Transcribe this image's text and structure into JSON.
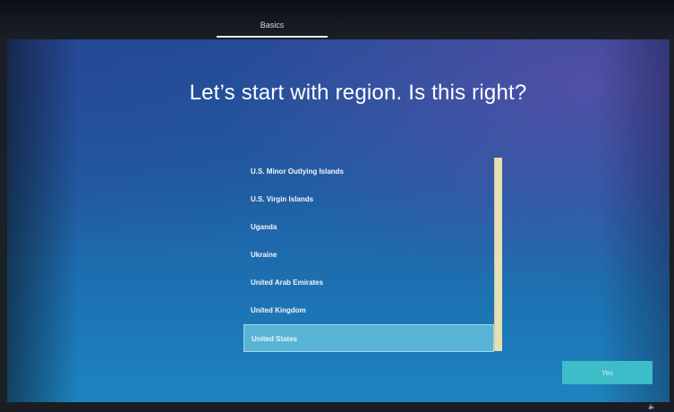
{
  "header": {
    "tab_label": "Basics"
  },
  "page": {
    "title": "Let’s start with region. Is this right?"
  },
  "regions": [
    {
      "label": "U.S. Minor Outlying Islands",
      "selected": false
    },
    {
      "label": "U.S. Virgin Islands",
      "selected": false
    },
    {
      "label": "Uganda",
      "selected": false
    },
    {
      "label": "Ukraine",
      "selected": false
    },
    {
      "label": "United Arab Emirates",
      "selected": false
    },
    {
      "label": "United Kingdom",
      "selected": false
    },
    {
      "label": "United States",
      "selected": true
    }
  ],
  "actions": {
    "yes_label": "Yes"
  },
  "taskbar": {
    "volume_icon": "speaker-icon",
    "volume_glyph": "🔈"
  },
  "colors": {
    "accent": "#3dbdc8",
    "selected": "#58b4d6"
  }
}
